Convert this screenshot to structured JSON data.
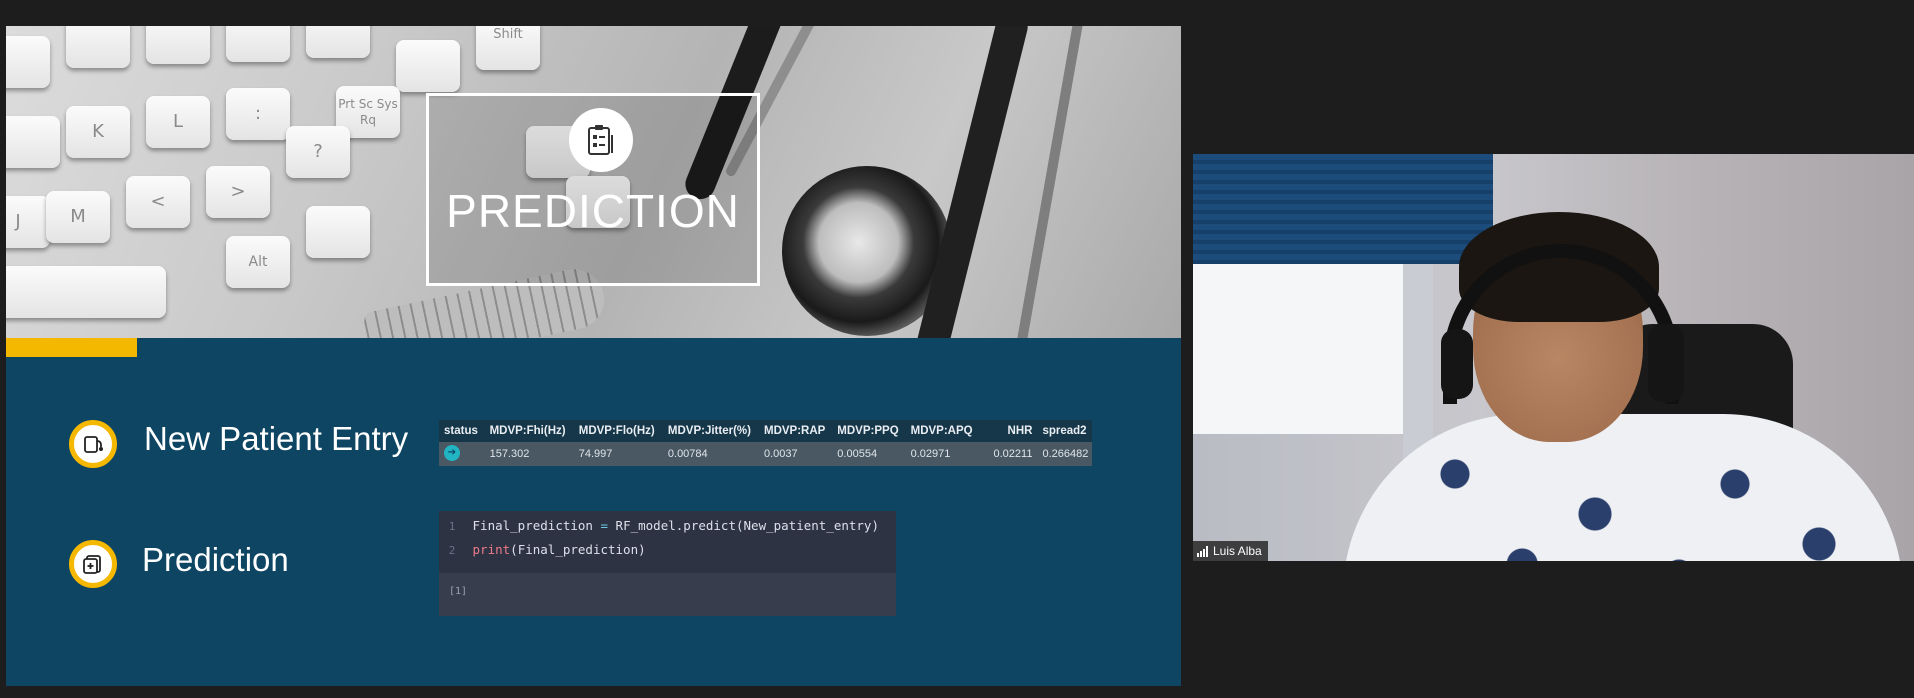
{
  "slide": {
    "title": "PREDICTION",
    "bullets": [
      {
        "label": "New Patient Entry",
        "icon": "clipboard-stethoscope-icon"
      },
      {
        "label": "Prediction",
        "icon": "medical-report-icon"
      }
    ],
    "keyboard_keys": [
      "Shift",
      "Prt Sc Sys Rq",
      "Alt",
      "K",
      "L",
      "M",
      "J",
      "?",
      "<",
      ">",
      ":"
    ],
    "accent_color": "#f5b800",
    "background_color": "#0e4562"
  },
  "data_table": {
    "headers": [
      "status",
      "MDVP:Fhi(Hz)",
      "MDVP:Flo(Hz)",
      "MDVP:Jitter(%)",
      "MDVP:RAP",
      "MDVP:PPQ",
      "MDVP:APQ",
      "NHR",
      "spread2"
    ],
    "row": [
      "",
      "157.302",
      "74.997",
      "0.00784",
      "0.0037",
      "0.00554",
      "0.02971",
      "0.02211",
      "0.266482"
    ]
  },
  "code_cell": {
    "lines": [
      {
        "num": "1",
        "text": "Final_prediction = RF_model.predict(New_patient_entry)"
      },
      {
        "num": "2",
        "text": "print(Final_prediction)"
      }
    ],
    "output_label": "[1]"
  },
  "video": {
    "participant_name": "Luis Alba"
  }
}
